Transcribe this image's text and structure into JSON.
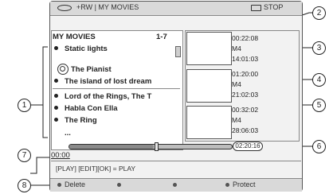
{
  "header": {
    "disc_label": "+RW | MY MOVIES",
    "stop_label": "STOP"
  },
  "list": {
    "title": "MY MOVIES",
    "count": "1-7",
    "items_group1": [
      "Static lights",
      "The Pianist",
      "The island of lost dream"
    ],
    "items_group2": [
      "Lord of the Rings, The T",
      "Habla Con Ella",
      "The Ring",
      "..."
    ]
  },
  "details": [
    {
      "time": "00:22:08",
      "format": "M4",
      "duration": "14:01:03"
    },
    {
      "time": "01:20:00",
      "format": "M4",
      "duration": "21:02:03"
    },
    {
      "time": "00:32:02",
      "format": "M4",
      "duration": "28:06:03"
    }
  ],
  "playback": {
    "total_time": "02:20:16",
    "current_time": "00:00",
    "progress": 0.52
  },
  "hint": "[PLAY] [EDIT][OK] = PLAY",
  "footer": {
    "delete_label": "Delete",
    "protect_label": "Protect"
  },
  "callouts": [
    "1",
    "2",
    "3",
    "4",
    "5",
    "6",
    "7",
    "8"
  ]
}
